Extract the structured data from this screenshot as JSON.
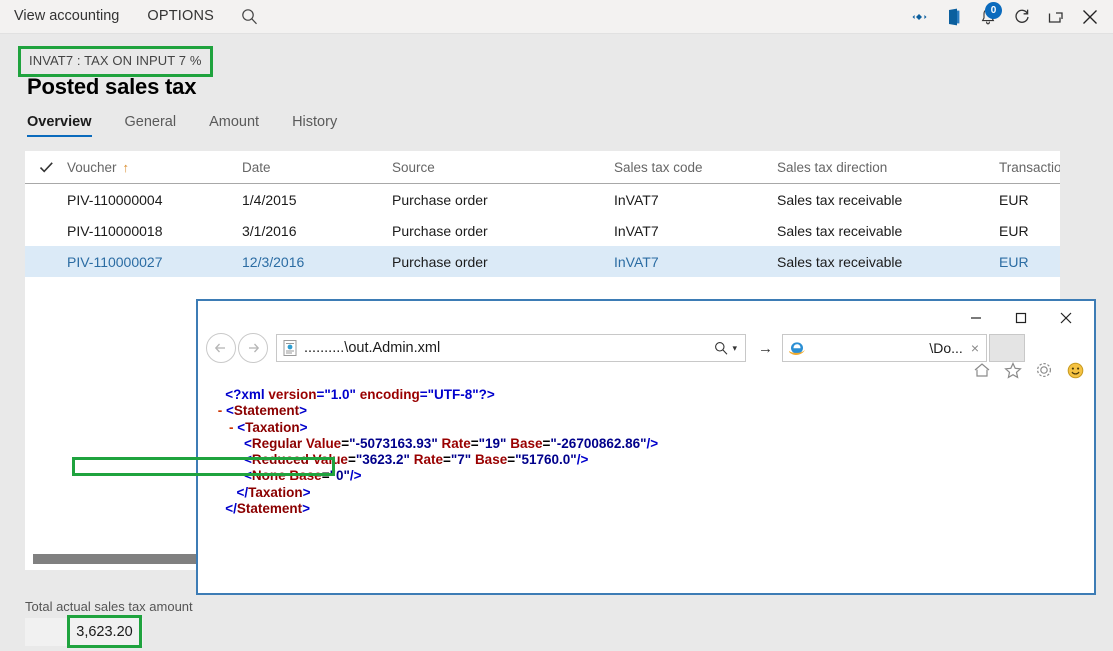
{
  "topbar": {
    "menu": [
      {
        "label": "View accounting",
        "name": "menu-view-accounting"
      },
      {
        "label": "OPTIONS",
        "name": "menu-options"
      }
    ],
    "search_icon": "search-icon",
    "right_icons": [
      {
        "name": "diamond-settings-icon",
        "glyph": "❖"
      },
      {
        "name": "office-app-icon",
        "glyph": "◧"
      },
      {
        "name": "notifications-bell-icon",
        "glyph": "bell",
        "badge": "0"
      },
      {
        "name": "refresh-icon",
        "glyph": "↻"
      },
      {
        "name": "open-in-new-window-icon",
        "glyph": "↗"
      },
      {
        "name": "close-icon",
        "glyph": "✕"
      }
    ]
  },
  "header": {
    "caption": "INVAT7 : TAX ON INPUT 7 %",
    "title": "Posted sales tax",
    "highlight_color": "#1fa33e"
  },
  "tabs": [
    {
      "label": "Overview",
      "active": true
    },
    {
      "label": "General",
      "active": false
    },
    {
      "label": "Amount",
      "active": false
    },
    {
      "label": "History",
      "active": false
    }
  ],
  "grid": {
    "columns": [
      {
        "label": "",
        "key": "check"
      },
      {
        "label": "Voucher",
        "key": "voucher",
        "sorted": "ascending",
        "sort_glyph": "↑"
      },
      {
        "label": "Date",
        "key": "date"
      },
      {
        "label": "Source",
        "key": "source"
      },
      {
        "label": "Sales tax code",
        "key": "code"
      },
      {
        "label": "Sales tax direction",
        "key": "direction"
      },
      {
        "label": "Transaction",
        "key": "transaction"
      }
    ],
    "rows": [
      {
        "voucher": "PIV-110000004",
        "date": "1/4/2015",
        "source": "Purchase order",
        "code": "InVAT7",
        "direction": "Sales tax receivable",
        "transaction": "EUR",
        "selected": false
      },
      {
        "voucher": "PIV-110000018",
        "date": "3/1/2016",
        "source": "Purchase order",
        "code": "InVAT7",
        "direction": "Sales tax receivable",
        "transaction": "EUR",
        "selected": false
      },
      {
        "voucher": "PIV-110000027",
        "date": "12/3/2016",
        "source": "Purchase order",
        "code": "InVAT7",
        "direction": "Sales tax receivable",
        "transaction": "EUR",
        "selected": true
      }
    ]
  },
  "footer": {
    "total_label": "Total actual sales tax amount",
    "total_value": "3,623.20",
    "highlight_color": "#1fa33e"
  },
  "browser": {
    "address_value": "..........\\out.Admin.xml",
    "tab_title": "\\Do...",
    "tab_close": "×",
    "window_controls": {
      "minimize": "—",
      "maximize": "□",
      "close": "✕"
    },
    "nav": {
      "back": "←",
      "forward": "→",
      "go": "→",
      "search_dropdown": "▾"
    },
    "command_icons": [
      {
        "name": "home-icon",
        "glyph": "⌂"
      },
      {
        "name": "favorites-star-icon",
        "glyph": "☆"
      },
      {
        "name": "tools-gear-icon",
        "glyph": "⚙"
      },
      {
        "name": "feedback-smiley-icon",
        "glyph": "☺"
      }
    ],
    "xml": {
      "declaration": {
        "open": "<?xml ",
        "attr1": "version",
        "val1": "\"1.0\"",
        "attr2": "encoding",
        "val2": "\"UTF-8\"",
        "close": "?>"
      },
      "lines": [
        {
          "indent": 2,
          "collapse": "",
          "type": "decl"
        },
        {
          "indent": 1,
          "collapse": "-",
          "type": "open",
          "tag": "Statement"
        },
        {
          "indent": 2,
          "collapse": "-",
          "type": "open",
          "tag": "Taxation"
        },
        {
          "indent": 4,
          "collapse": "",
          "type": "empty",
          "tag": "Regular",
          "attrs": [
            [
              "Value",
              "-5073163.93"
            ],
            [
              "Rate",
              "19"
            ],
            [
              "Base",
              "-26700862.86"
            ]
          ]
        },
        {
          "indent": 4,
          "collapse": "",
          "type": "empty",
          "tag": "Reduced",
          "attrs": [
            [
              "Value",
              "3623.2"
            ],
            [
              "Rate",
              "7"
            ],
            [
              "Base",
              "51760.0"
            ]
          ],
          "highlighted": true
        },
        {
          "indent": 4,
          "collapse": "",
          "type": "empty",
          "tag": "None",
          "attrs": [
            [
              "Base",
              "0"
            ]
          ]
        },
        {
          "indent": 3,
          "collapse": "",
          "type": "close",
          "tag": "Taxation"
        },
        {
          "indent": 2,
          "collapse": "",
          "type": "close",
          "tag": "Statement"
        }
      ]
    }
  }
}
